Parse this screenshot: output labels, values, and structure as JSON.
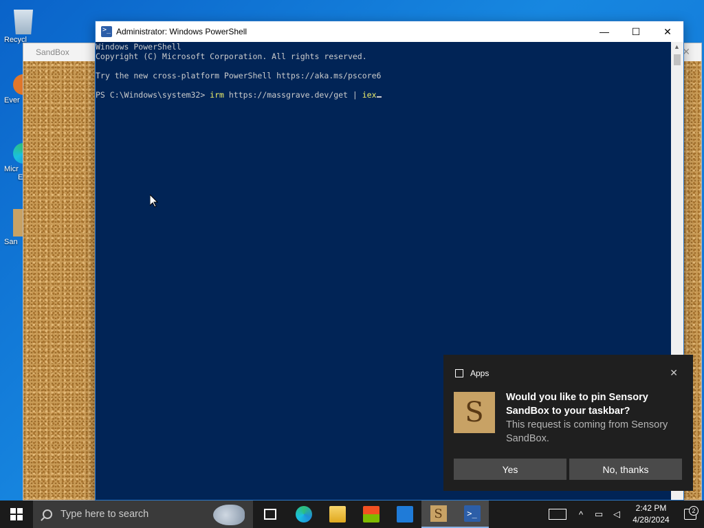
{
  "desktop": {
    "icons": [
      {
        "label": "Recycl"
      },
      {
        "label": "Ever"
      },
      {
        "label": "Micr"
      },
      {
        "label": "E"
      },
      {
        "label": "San"
      }
    ]
  },
  "sandbox_window": {
    "title": "SandBox",
    "close": "✕"
  },
  "powershell": {
    "title": "Administrator: Windows PowerShell",
    "minimize": "—",
    "maximize": "☐",
    "close": "✕",
    "lines": [
      "Windows PowerShell",
      "Copyright (C) Microsoft Corporation. All rights reserved.",
      "",
      "Try the new cross-platform PowerShell https://aka.ms/pscore6",
      ""
    ],
    "prompt": "PS C:\\Windows\\system32> ",
    "command": "irm",
    "argument": " https://massgrave.dev/get | ",
    "pipe_cmd": "iex"
  },
  "toast": {
    "app": "Apps",
    "close": "✕",
    "image_letter": "S",
    "title": "Would you like to pin Sensory SandBox to your taskbar?",
    "text": "This request is coming from Sensory SandBox.",
    "yes_label": "Yes",
    "no_label": "No, thanks"
  },
  "taskbar": {
    "search_placeholder": "Type here to search",
    "sandbox_letter": "S",
    "pwsh_glyph": ">_",
    "clock_time": "2:42 PM",
    "clock_date": "4/28/2024",
    "notification_count": "2",
    "tray_chevron": "^",
    "colors": {
      "background": "#1b1b1b",
      "active": "#4a4a4a"
    }
  }
}
